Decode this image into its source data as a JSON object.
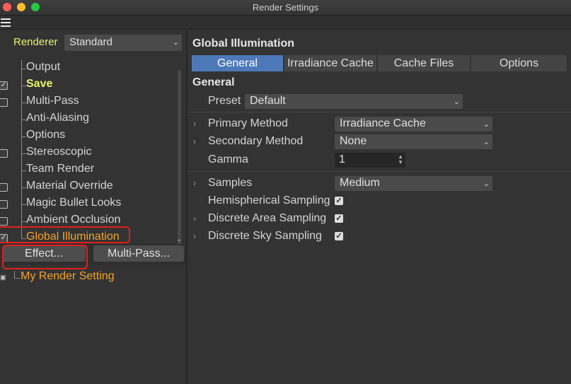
{
  "window": {
    "title": "Render Settings"
  },
  "left": {
    "renderer_label": "Renderer",
    "renderer_value": "Standard",
    "items": [
      {
        "label": "Output",
        "checkbox": "none",
        "style": "normal"
      },
      {
        "label": "Save",
        "checkbox": "checked",
        "style": "active"
      },
      {
        "label": "Multi-Pass",
        "checkbox": "unchecked",
        "style": "normal"
      },
      {
        "label": "Anti-Aliasing",
        "checkbox": "none",
        "style": "normal"
      },
      {
        "label": "Options",
        "checkbox": "none",
        "style": "normal"
      },
      {
        "label": "Stereoscopic",
        "checkbox": "unchecked",
        "style": "normal"
      },
      {
        "label": "Team Render",
        "checkbox": "none",
        "style": "normal"
      },
      {
        "label": "Material Override",
        "checkbox": "unchecked",
        "style": "normal"
      },
      {
        "label": "Magic Bullet Looks",
        "checkbox": "unchecked",
        "style": "normal"
      },
      {
        "label": "Ambient Occlusion",
        "checkbox": "unchecked",
        "style": "normal"
      },
      {
        "label": "Global Illumination",
        "checkbox": "checked",
        "style": "orange"
      }
    ],
    "effect_button": "Effect...",
    "multipass_button": "Multi-Pass...",
    "render_setting_name": "My Render Setting"
  },
  "right": {
    "title": "Global Illumination",
    "tabs": [
      {
        "label": "General",
        "selected": true
      },
      {
        "label": "Irradiance Cache",
        "selected": false
      },
      {
        "label": "Cache Files",
        "selected": false
      },
      {
        "label": "Options",
        "selected": false
      }
    ],
    "section_title": "General",
    "preset": {
      "label": "Preset",
      "value": "Default"
    },
    "primary_method": {
      "label": "Primary Method",
      "value": "Irradiance Cache"
    },
    "secondary_method": {
      "label": "Secondary Method",
      "value": "None"
    },
    "gamma": {
      "label": "Gamma",
      "value": "1"
    },
    "samples": {
      "label": "Samples",
      "value": "Medium"
    },
    "hemispherical_sampling": {
      "label": "Hemispherical Sampling",
      "checked": true
    },
    "discrete_area_sampling": {
      "label": "Discrete Area Sampling",
      "checked": true
    },
    "discrete_sky_sampling": {
      "label": "Discrete Sky Sampling",
      "checked": true
    }
  },
  "colors": {
    "accent_tab": "#4e79b8",
    "active_item": "#e6f56a",
    "orange_item": "#f4a12c",
    "highlight": "#e0201c"
  }
}
